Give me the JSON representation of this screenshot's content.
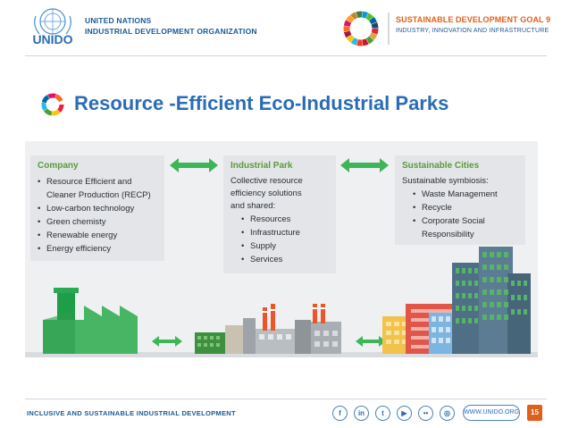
{
  "header": {
    "org_name_line1": "UNITED NATIONS",
    "org_name_line2": "INDUSTRIAL DEVELOPMENT ORGANIZATION",
    "logo_text": "UNIDO",
    "sdg_title": "SUSTAINABLE DEVELOPMENT GOAL 9",
    "sdg_subtitle": "INDUSTRY, INNOVATION AND INFRASTRUCTURE"
  },
  "slide": {
    "title": "Resource -Efficient Eco-Industrial Parks"
  },
  "boxes": {
    "company": {
      "heading": "Company",
      "items": [
        "Resource Efficient and",
        "Cleaner Production (RECP)",
        "Low-carbon technology",
        "Green chemisty",
        "Renewable energy",
        "Energy efficiency"
      ]
    },
    "industrial_park": {
      "heading": "Industrial Park",
      "intro_line1": "Collective resource",
      "intro_line2": "efficiency solutions",
      "intro_line3": "and shared:",
      "items": [
        "Resources",
        "Infrastructure",
        "Supply",
        "Services"
      ]
    },
    "sustainable_cities": {
      "heading": "Sustainable Cities",
      "intro": "Sustainable symbiosis:",
      "items": [
        "Waste Management",
        "Recycle",
        "Corporate Social",
        "Responsibility"
      ]
    }
  },
  "footer": {
    "tagline": "INCLUSIVE AND SUSTAINABLE INDUSTRIAL DEVELOPMENT",
    "website": "WWW.UNIDO.ORG",
    "page_number": "15",
    "social": [
      {
        "icon": "facebook-icon",
        "glyph": "f"
      },
      {
        "icon": "linkedin-icon",
        "glyph": "in"
      },
      {
        "icon": "twitter-icon",
        "glyph": "t"
      },
      {
        "icon": "youtube-icon",
        "glyph": "▶"
      },
      {
        "icon": "flickr-icon",
        "glyph": "••"
      },
      {
        "icon": "instagram-icon",
        "glyph": "◎"
      }
    ]
  },
  "colors": {
    "brand_blue": "#2a6cb5",
    "sdg_orange": "#e0601b",
    "heading_green": "#5a9a3c",
    "arrow_green": "#3fb55a"
  }
}
